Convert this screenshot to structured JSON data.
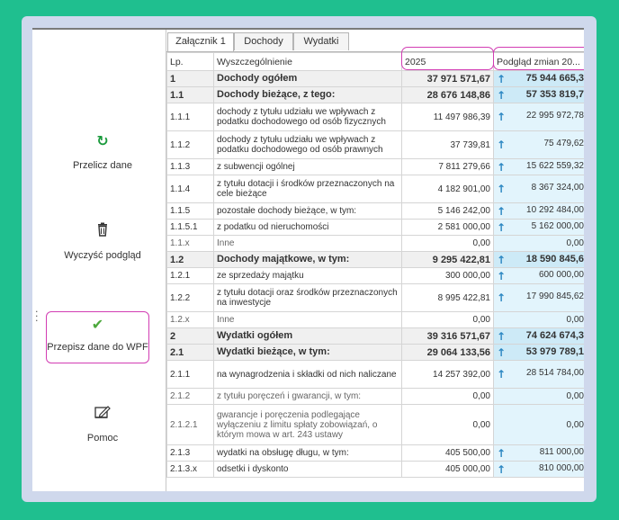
{
  "sidebar": {
    "recalc": {
      "icon": "refresh-icon",
      "label": "Przelicz dane"
    },
    "clear": {
      "icon": "trash-icon",
      "label": "Wyczyść podgląd"
    },
    "copy": {
      "icon": "checkmark-icon",
      "label": "Przepisz dane do WPF"
    },
    "help": {
      "icon": "edit-document-icon",
      "label": "Pomoc"
    }
  },
  "tabs": [
    "Załącznik 1",
    "Dochody",
    "Wydatki"
  ],
  "columns": {
    "lp": "Lp.",
    "desc": "Wyszczególnienie",
    "year": "2025",
    "preview": "Podgląd zmian 20..."
  },
  "rows": [
    {
      "lp": "1",
      "desc": "Dochody ogółem",
      "v": "37 971 571,67",
      "p": "75 944 665,3",
      "arrow": true,
      "bold": true
    },
    {
      "lp": "1.1",
      "desc": "Dochody bieżące, z tego:",
      "v": "28 676 148,86",
      "p": "57 353 819,7",
      "arrow": true,
      "bold": true
    },
    {
      "lp": "1.1.1",
      "desc": "dochody z tytułu udziału we wpływach z podatku dochodowego od osób fizycznych",
      "v": "11 497 986,39",
      "p": "22 995 972,78",
      "arrow": true
    },
    {
      "lp": "1.1.2",
      "desc": "dochody z tytułu udziału we wpływach z podatku dochodowego od osób prawnych",
      "v": "37 739,81",
      "p": "75 479,62",
      "arrow": true
    },
    {
      "lp": "1.1.3",
      "desc": "z subwencji ogólnej",
      "v": "7 811 279,66",
      "p": "15 622 559,32",
      "arrow": true
    },
    {
      "lp": "1.1.4",
      "desc": "z tytułu dotacji i środków przeznaczonych na cele bieżące",
      "v": "4 182 901,00",
      "p": "8 367 324,00",
      "arrow": true
    },
    {
      "lp": "1.1.5",
      "desc": "pozostałe dochody bieżące, w tym:",
      "v": "5 146 242,00",
      "p": "10 292 484,00",
      "arrow": true
    },
    {
      "lp": "1.1.5.1",
      "desc": "z podatku od nieruchomości",
      "v": "2 581 000,00",
      "p": "5 162 000,00",
      "arrow": true
    },
    {
      "lp": "1.1.x",
      "desc": "Inne",
      "v": "0,00",
      "p": "0,00",
      "arrow": false,
      "dim": true
    },
    {
      "lp": "1.2",
      "desc": "Dochody majątkowe, w tym:",
      "v": "9 295 422,81",
      "p": "18 590 845,6",
      "arrow": true,
      "bold": true
    },
    {
      "lp": "1.2.1",
      "desc": "ze sprzedaży majątku",
      "v": "300 000,00",
      "p": "600 000,00",
      "arrow": true
    },
    {
      "lp": "1.2.2",
      "desc": "z tytułu dotacji oraz środków przeznaczonych na inwestycje",
      "v": "8 995 422,81",
      "p": "17 990 845,62",
      "arrow": true
    },
    {
      "lp": "1.2.x",
      "desc": "Inne",
      "v": "0,00",
      "p": "0,00",
      "arrow": false,
      "dim": true
    },
    {
      "lp": "2",
      "desc": "Wydatki ogółem",
      "v": "39 316 571,67",
      "p": "74 624 674,3",
      "arrow": true,
      "bold": true
    },
    {
      "lp": "2.1",
      "desc": "Wydatki bieżące, w tym:",
      "v": "29 064 133,56",
      "p": "53 979 789,1",
      "arrow": true,
      "bold": true
    },
    {
      "lp": "2.1.1",
      "desc": "na wynagrodzenia i składki od nich naliczane",
      "v": "14 257 392,00",
      "p": "28 514 784,00",
      "arrow": true
    },
    {
      "lp": "2.1.2",
      "desc": "z tytułu poręczeń i gwarancji, w tym:",
      "v": "0,00",
      "p": "0,00",
      "arrow": false,
      "dim": true
    },
    {
      "lp": "2.1.2.1",
      "desc": "gwarancje i poręczenia podlegające wyłączeniu z limitu spłaty zobowiązań, o którym mowa w art. 243 ustawy",
      "v": "0,00",
      "p": "0,00",
      "arrow": false,
      "dim": true
    },
    {
      "lp": "2.1.3",
      "desc": "wydatki na obsługę długu, w tym:",
      "v": "405 500,00",
      "p": "811 000,00",
      "arrow": true
    },
    {
      "lp": "2.1.3.x",
      "desc": "odsetki i dyskonto",
      "v": "405 000,00",
      "p": "810 000,00",
      "arrow": true
    }
  ]
}
